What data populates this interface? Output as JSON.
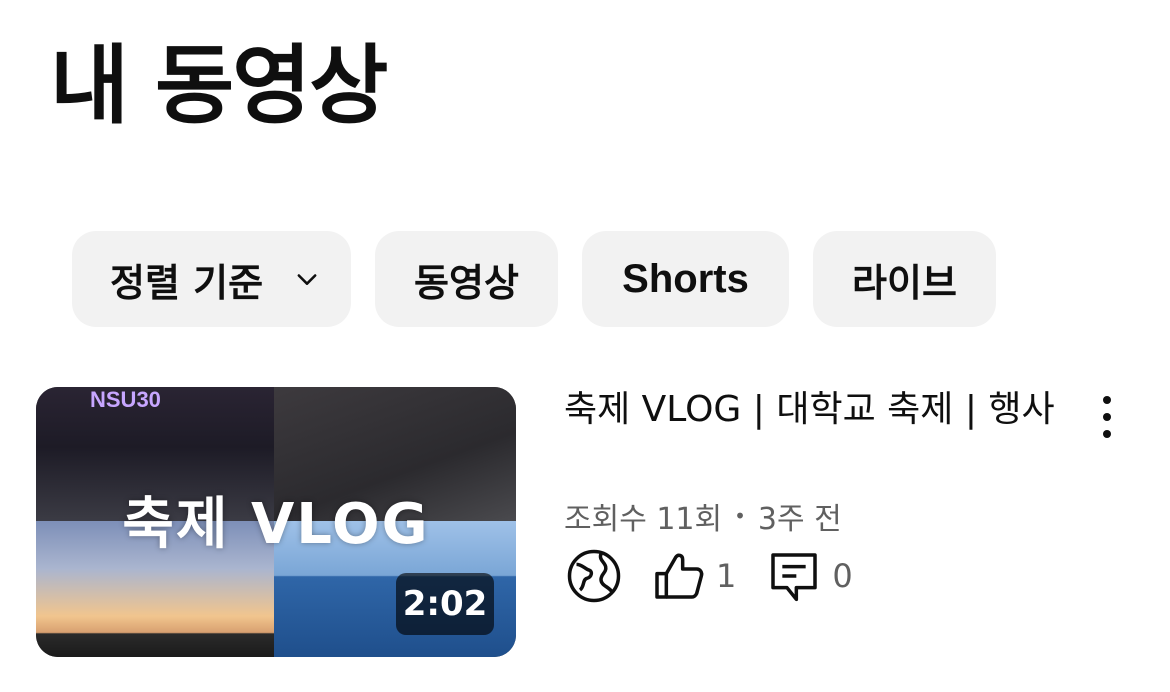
{
  "header": {
    "title": "내 동영상"
  },
  "filters": {
    "sort_label": "정렬 기준",
    "chips": [
      "동영상",
      "Shorts",
      "라이브"
    ]
  },
  "video": {
    "thumbnail_overlay_text": "축제 VLOG",
    "thumbnail_tag": "NSU30",
    "duration": "2:02",
    "title": "축제 VLOG | 대학교 축제 | 행사",
    "views": "조회수 11회",
    "separator": "•",
    "age": "3주 전",
    "visibility_icon": "globe-icon",
    "likes": "1",
    "comments": "0"
  }
}
